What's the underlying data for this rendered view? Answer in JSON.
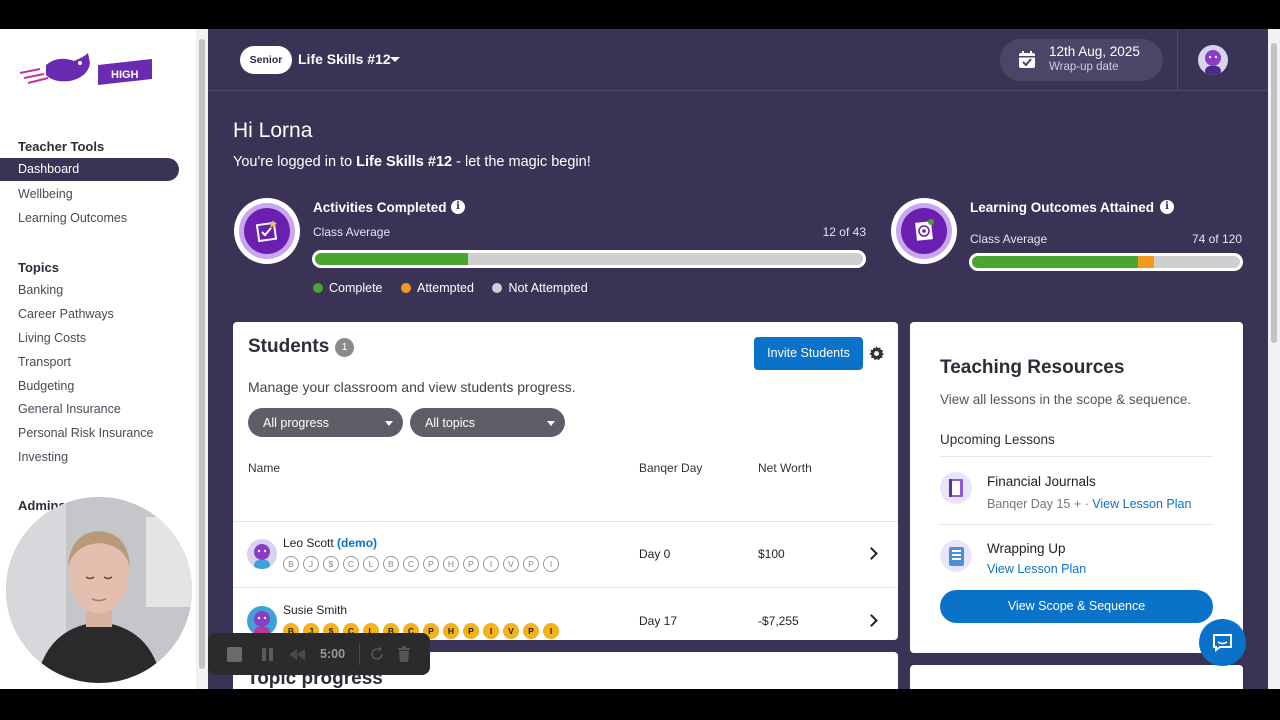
{
  "brand": {
    "logo_text": "HIGH"
  },
  "sidebar": {
    "sections": [
      {
        "heading": "Teacher Tools",
        "items": [
          "Dashboard",
          "Wellbeing",
          "Learning Outcomes"
        ]
      },
      {
        "heading": "Topics",
        "items": [
          "Banking",
          "Career Pathways",
          "Living Costs",
          "Transport",
          "Budgeting",
          "General Insurance",
          "Personal Risk Insurance",
          "Investing"
        ]
      },
      {
        "heading": "Admins",
        "items": []
      }
    ],
    "active_item": "Dashboard"
  },
  "header": {
    "level_badge": "Senior",
    "class_name": "Life Skills #12",
    "date": "12th Aug, 2025",
    "date_label": "Wrap-up date"
  },
  "greeting": {
    "title": "Hi Lorna",
    "prefix": "You're logged in to ",
    "class_name": "Life Skills #12",
    "suffix": " - let the magic begin!"
  },
  "activities": {
    "title": "Activities Completed",
    "label": "Class Average",
    "count": "12 of 43",
    "complete_fraction": 0.28,
    "attempted_fraction": 0.0
  },
  "outcomes": {
    "title": "Learning Outcomes Attained",
    "label": "Class Average",
    "count": "74 of 120",
    "complete_fraction": 0.62,
    "attempted_fraction": 0.06
  },
  "legend": {
    "complete": "Complete",
    "attempted": "Attempted",
    "not_attempted": "Not Attempted"
  },
  "colors": {
    "complete": "#4aa52e",
    "attempted": "#f39a1e",
    "not_attempted": "#cfcfcf",
    "accent": "#0b72c9",
    "background": "#3b3355"
  },
  "students": {
    "title": "Students",
    "count": "1",
    "invite_label": "Invite Students",
    "description": "Manage your classroom and view students progress.",
    "filter_progress": "All progress",
    "filter_topics": "All topics",
    "columns": {
      "name": "Name",
      "day": "Banqer Day",
      "worth": "Net Worth"
    },
    "topic_letters": [
      "B",
      "J",
      "$",
      "C",
      "L",
      "B",
      "C",
      "P",
      "H",
      "P",
      "I",
      "V",
      "P",
      "I"
    ],
    "rows": [
      {
        "name": "Leo Scott",
        "tag": "(demo)",
        "day": "Day 0",
        "worth": "$100",
        "topics_done": 0
      },
      {
        "name": "Susie Smith",
        "tag": "",
        "day": "Day 17",
        "worth": "-$7,255",
        "topics_done": 14
      }
    ]
  },
  "topic_progress": {
    "title": "Topic progress"
  },
  "resources": {
    "title": "Teaching Resources",
    "description": "View all lessons in the scope & sequence.",
    "upcoming_heading": "Upcoming Lessons",
    "lessons": [
      {
        "name": "Financial Journals",
        "meta": "Banqer Day 15 + · ",
        "link": "View Lesson Plan"
      },
      {
        "name": "Wrapping Up",
        "meta": "",
        "link": "View Lesson Plan"
      }
    ],
    "scope_button": "View Scope & Sequence"
  },
  "recorder": {
    "time": "5:00"
  }
}
